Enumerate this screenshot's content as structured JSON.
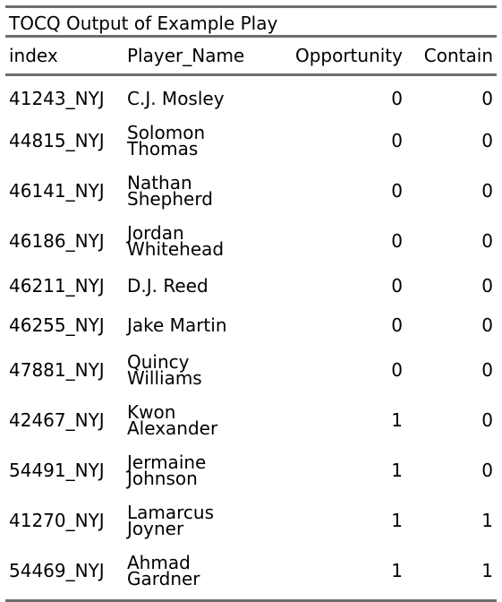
{
  "chart_data": {
    "type": "table",
    "title": "TOCQ Output of Example Play",
    "columns": [
      "index",
      "Player_Name",
      "Opportunity",
      "Contain"
    ],
    "rows": [
      {
        "index": "41243_NYJ",
        "name_lines": [
          "C.J. Mosley"
        ],
        "opportunity": "0",
        "contain": "0"
      },
      {
        "index": "44815_NYJ",
        "name_lines": [
          "Solomon",
          "Thomas"
        ],
        "opportunity": "0",
        "contain": "0"
      },
      {
        "index": "46141_NYJ",
        "name_lines": [
          "Nathan",
          "Shepherd"
        ],
        "opportunity": "0",
        "contain": "0"
      },
      {
        "index": "46186_NYJ",
        "name_lines": [
          "Jordan",
          "Whitehead"
        ],
        "opportunity": "0",
        "contain": "0"
      },
      {
        "index": "46211_NYJ",
        "name_lines": [
          "D.J. Reed"
        ],
        "opportunity": "0",
        "contain": "0"
      },
      {
        "index": "46255_NYJ",
        "name_lines": [
          "Jake Martin"
        ],
        "opportunity": "0",
        "contain": "0"
      },
      {
        "index": "47881_NYJ",
        "name_lines": [
          "Quincy",
          "Williams"
        ],
        "opportunity": "0",
        "contain": "0"
      },
      {
        "index": "42467_NYJ",
        "name_lines": [
          "Kwon",
          "Alexander"
        ],
        "opportunity": "1",
        "contain": "0"
      },
      {
        "index": "54491_NYJ",
        "name_lines": [
          "Jermaine",
          "Johnson"
        ],
        "opportunity": "1",
        "contain": "0"
      },
      {
        "index": "41270_NYJ",
        "name_lines": [
          "Lamarcus",
          "Joyner"
        ],
        "opportunity": "1",
        "contain": "1"
      },
      {
        "index": "54469_NYJ",
        "name_lines": [
          "Ahmad",
          "Gardner"
        ],
        "opportunity": "1",
        "contain": "1"
      }
    ]
  },
  "colors": {
    "rule": "#6e6e6e",
    "text": "#000000",
    "background": "#ffffff"
  }
}
